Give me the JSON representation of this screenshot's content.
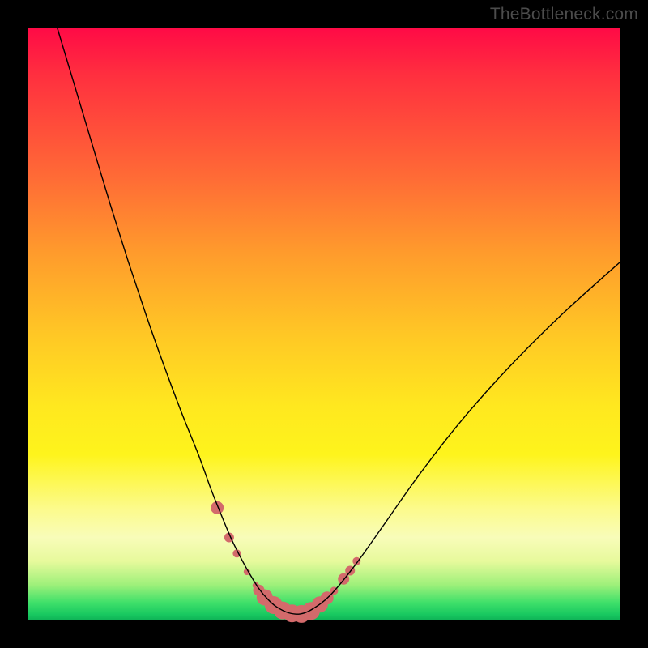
{
  "watermark": "TheBottleneck.com",
  "chart_data": {
    "type": "line",
    "title": "",
    "xlabel": "",
    "ylabel": "",
    "xlim": [
      0,
      100
    ],
    "ylim": [
      0,
      100
    ],
    "grid": false,
    "series": [
      {
        "name": "bottleneck-curve",
        "color": "#000000",
        "stroke_width": 1.4,
        "x": [
          5,
          8,
          11,
          14,
          17,
          20,
          23,
          26,
          29,
          31,
          33,
          34.5,
          36,
          37.5,
          39,
          40.5,
          42,
          44,
          46,
          48,
          51,
          55,
          60,
          66,
          73,
          81,
          90,
          100
        ],
        "y": [
          100,
          90,
          80,
          70,
          60.5,
          51.5,
          43,
          35,
          27.5,
          22,
          17,
          13.5,
          10.5,
          7.8,
          5.4,
          3.6,
          2.3,
          1.3,
          1.1,
          1.9,
          4.2,
          9,
          16,
          24.5,
          33.5,
          42.5,
          51.5,
          60.5
        ]
      }
    ],
    "markers": {
      "name": "highlight-dots",
      "color": "#d36a6b",
      "radius_range": [
        4,
        11
      ],
      "points": [
        {
          "x": 32.0,
          "y": 19.0,
          "r": 8
        },
        {
          "x": 34.0,
          "y": 14.0,
          "r": 6
        },
        {
          "x": 35.3,
          "y": 11.3,
          "r": 5
        },
        {
          "x": 37.0,
          "y": 8.2,
          "r": 4
        },
        {
          "x": 38.5,
          "y": 5.9,
          "r": 4
        },
        {
          "x": 39.0,
          "y": 5.1,
          "r": 7
        },
        {
          "x": 40.0,
          "y": 3.9,
          "r": 10
        },
        {
          "x": 41.5,
          "y": 2.6,
          "r": 11
        },
        {
          "x": 43.0,
          "y": 1.7,
          "r": 11
        },
        {
          "x": 44.6,
          "y": 1.2,
          "r": 11
        },
        {
          "x": 46.2,
          "y": 1.1,
          "r": 11
        },
        {
          "x": 47.8,
          "y": 1.6,
          "r": 11
        },
        {
          "x": 49.3,
          "y": 2.7,
          "r": 10
        },
        {
          "x": 50.5,
          "y": 3.8,
          "r": 8
        },
        {
          "x": 51.7,
          "y": 5.0,
          "r": 5
        },
        {
          "x": 53.3,
          "y": 7.0,
          "r": 7
        },
        {
          "x": 54.4,
          "y": 8.4,
          "r": 6
        },
        {
          "x": 55.5,
          "y": 10.0,
          "r": 5
        }
      ]
    },
    "background_gradient_stops": [
      {
        "pos": 0.0,
        "color": "#ff0a46"
      },
      {
        "pos": 0.25,
        "color": "#ff6a36"
      },
      {
        "pos": 0.52,
        "color": "#ffc825"
      },
      {
        "pos": 0.72,
        "color": "#fef41c"
      },
      {
        "pos": 0.9,
        "color": "#e7fa9c"
      },
      {
        "pos": 1.0,
        "color": "#0eb156"
      }
    ]
  }
}
